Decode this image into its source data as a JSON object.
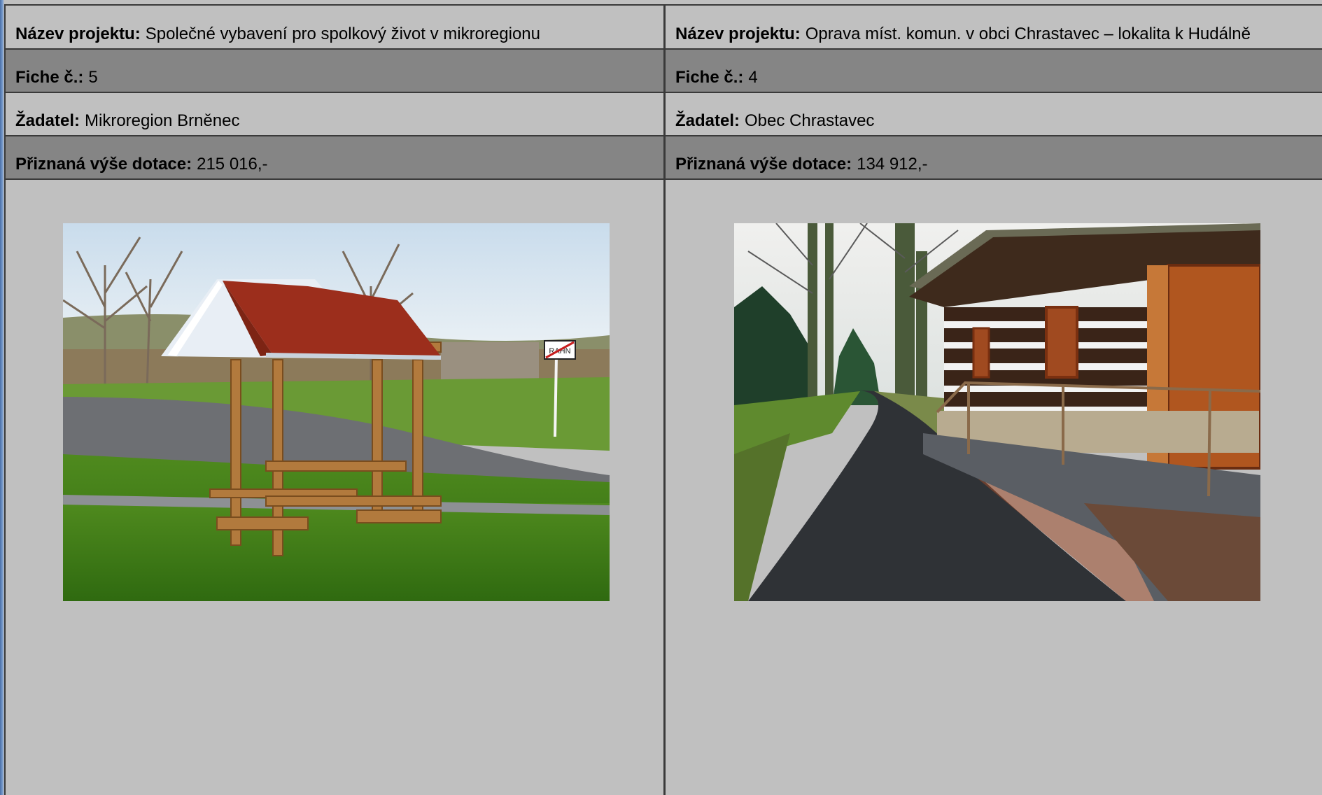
{
  "labels": {
    "project": "Název projektu:",
    "fiche": "Fiche č.:",
    "applicant": "Žadatel:",
    "subsidy": "Přiznaná výše dotace:"
  },
  "projects": [
    {
      "name": "Společné vybavení pro spolkový život v mikroregionu",
      "fiche": "5",
      "applicant": "Mikroregion Brněnec",
      "subsidy": "215 016,-",
      "photo_sign_text": "RAHN"
    },
    {
      "name": "Oprava míst. komun. v obci Chrastavec – lokalita k Hudálně",
      "fiche": "4",
      "applicant": "Obec Chrastavec",
      "subsidy": "134 912,-"
    }
  ]
}
